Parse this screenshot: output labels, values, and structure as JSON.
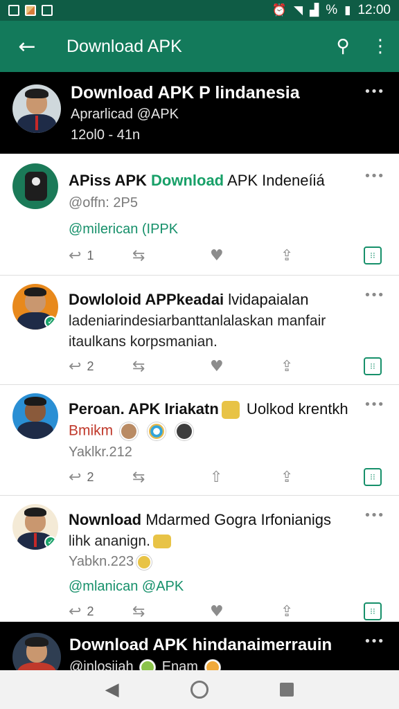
{
  "status_bar": {
    "time": "12:00",
    "battery_glyph": "%"
  },
  "app_bar": {
    "title": "Download APK"
  },
  "profile": {
    "name": "Download APK P lindanesia",
    "handle": "Aprarlicad @APK",
    "count": "12ol0 - 41n"
  },
  "tweets": [
    {
      "name_parts": [
        "APiss APK ",
        "Download",
        " APK Indeneíiá"
      ],
      "sub": "@offn: 2P5",
      "mention": "@milerican (IPPK",
      "reply_count": "1",
      "avatar_color": "#1b7a58"
    },
    {
      "name_bold": "Dowloloid APPkeadai",
      "name_rest": " lvidapaialan",
      "line2": "ladeniarindesiarbanttanlalaskan manfair",
      "line3": "itaulkans korpsmanian.",
      "reply_count": "2",
      "avatar_color": "#e8891c"
    },
    {
      "name_bold": "Peroan. APK Iriakatn",
      "name_rest": " Uolkod krentkh",
      "line2": "Bmikm",
      "sub": "Yaklkr.212",
      "reply_count": "2",
      "avatar_color": "#2a8fd4"
    },
    {
      "name_bold": "Nownload",
      "name_rest": " Mdarmed Gogra Irfonianigs",
      "line2": "lihk ananign.",
      "sub": "Yabkn.223",
      "mention": "@mlanican @APK",
      "reply_count": "2",
      "avatar_color": "#f4ead6"
    }
  ],
  "footer_profile": {
    "name": "Download APK hindanaimerrauin",
    "sub": "@inlosiiah",
    "sub2": "Enam"
  },
  "icons": {
    "back": "arrow-left",
    "search": "search",
    "more": "more-vert",
    "reply": "reply",
    "retweet": "retweet",
    "like": "heart",
    "share": "share",
    "grid": "grid"
  }
}
